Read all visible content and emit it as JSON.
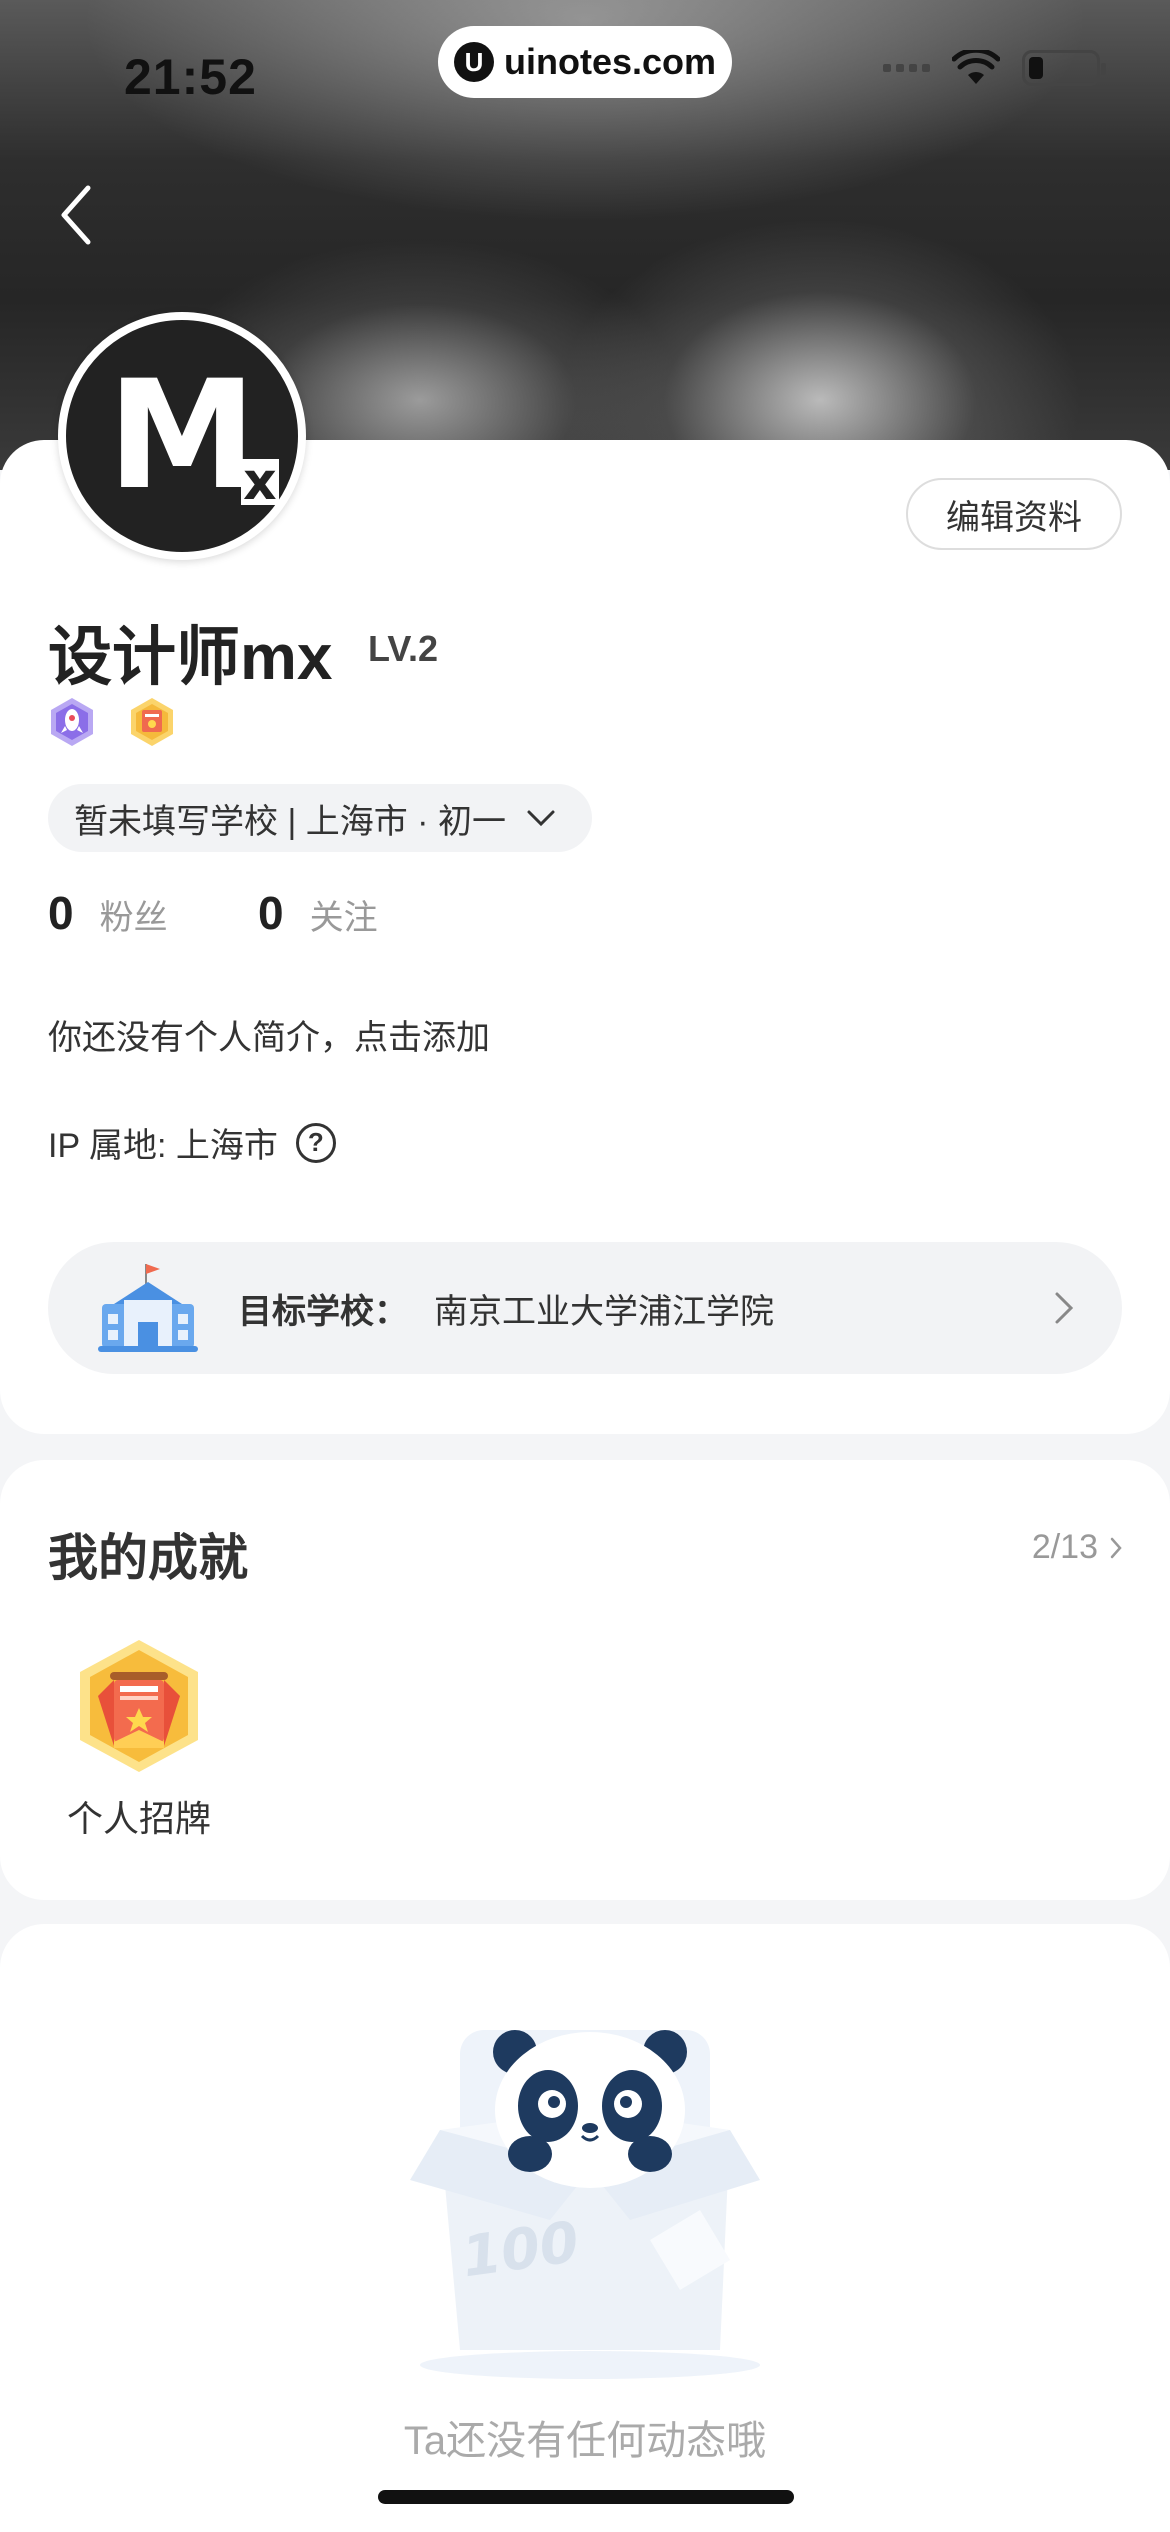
{
  "status_bar": {
    "time": "21:52",
    "url": "uinotes.com",
    "url_logo": "U"
  },
  "profile": {
    "avatar_initial": "M",
    "avatar_sub": "x",
    "edit_label": "编辑资料",
    "username": "设计师mx",
    "level": "LV.2",
    "school_info": "暂未填写学校 | 上海市 · 初一",
    "followers_count": "0",
    "followers_label": "粉丝",
    "following_count": "0",
    "following_label": "关注",
    "bio": "你还没有个人简介，点击添加",
    "ip_location": "IP 属地: 上海市",
    "target_school_label": "目标学校：",
    "target_school_value": "南京工业大学浦江学院"
  },
  "achievements": {
    "title": "我的成就",
    "count": "2/13",
    "items": [
      {
        "label": "个人招牌"
      }
    ]
  },
  "feed": {
    "empty_text": "Ta还没有任何动态哦",
    "box_text": "100"
  },
  "colors": {
    "accent_blue": "#4a90e2",
    "badge_gold": "#f5b93b",
    "badge_purple": "#8b6ee8"
  }
}
